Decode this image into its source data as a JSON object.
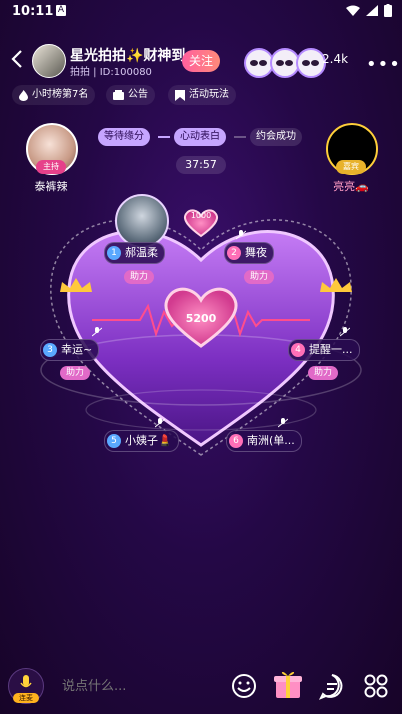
{
  "status": {
    "time": "10:11",
    "a_badge": "A"
  },
  "header": {
    "title": "星光拍拍✨财神到",
    "room_id": "拍拍 | ID:100080",
    "follow_label": "关注",
    "audience_count": "2.4k"
  },
  "chips": [
    {
      "label": "小时榜第7名",
      "icon": "fire-icon"
    },
    {
      "label": "公告",
      "icon": "announcement-icon"
    },
    {
      "label": "活动玩法",
      "icon": "bookmark-icon"
    }
  ],
  "host": {
    "tag": "主持",
    "name": "泰裤辣"
  },
  "guest": {
    "tag": "嘉宾",
    "name": "亮亮🚗"
  },
  "stages": [
    "等待缘分",
    "心动表白",
    "约会成功"
  ],
  "timer": "37:57",
  "heart": {
    "center_value": "5200",
    "top_value": "1000"
  },
  "seats": [
    {
      "num": "1",
      "name": "郝温柔",
      "help": "助力",
      "color": "#5aa8ff"
    },
    {
      "num": "2",
      "name": "舞夜",
      "help": "助力",
      "color": "#ff6fb7"
    },
    {
      "num": "3",
      "name": "幸运~",
      "help": "助力",
      "color": "#5aa8ff"
    },
    {
      "num": "4",
      "name": "提醒一...",
      "help": "助力",
      "color": "#ff6fb7"
    },
    {
      "num": "5",
      "name": "小姨子💄",
      "help": "",
      "color": "#5aa8ff"
    },
    {
      "num": "6",
      "name": "南洲(单...",
      "help": "",
      "color": "#ff6fb7"
    }
  ],
  "bottom": {
    "voice_tag": "连麦",
    "input_placeholder": "说点什么..."
  }
}
